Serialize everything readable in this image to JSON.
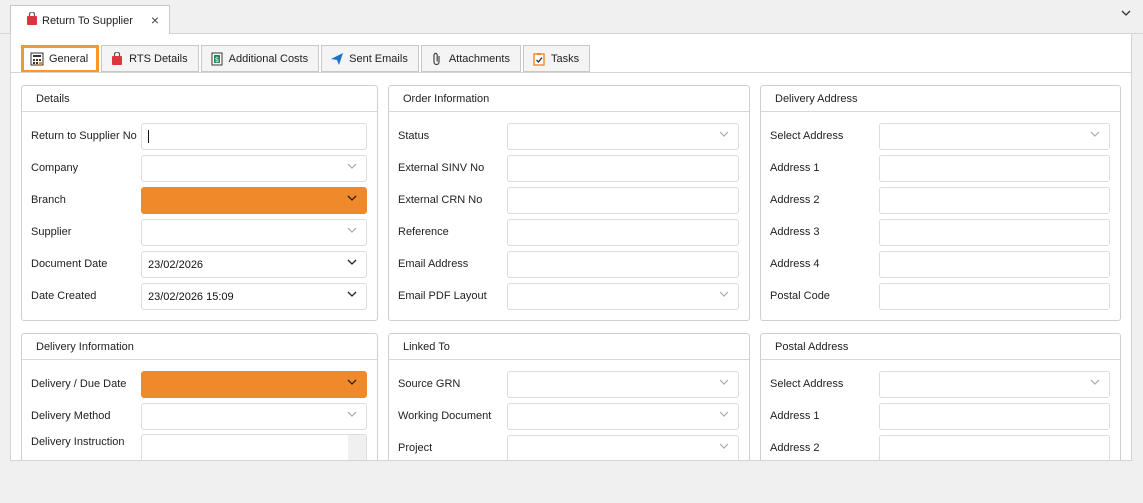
{
  "document_tab": {
    "title": "Return To Supplier",
    "close": "×"
  },
  "collapse_glyph": "⌄",
  "tabs": [
    {
      "label": "General",
      "icon": "calculator-icon"
    },
    {
      "label": "RTS Details",
      "icon": "shopping-bag-icon"
    },
    {
      "label": "Additional Costs",
      "icon": "dollar-document-icon"
    },
    {
      "label": "Sent Emails",
      "icon": "paper-plane-icon"
    },
    {
      "label": "Attachments",
      "icon": "paperclip-icon"
    },
    {
      "label": "Tasks",
      "icon": "clipboard-check-icon"
    }
  ],
  "colors": {
    "accent": "#f0892a",
    "active_tab_border": "#f39a2b"
  },
  "details": {
    "title": "Details",
    "return_no_label": "Return to Supplier No",
    "company_label": "Company",
    "branch_label": "Branch",
    "supplier_label": "Supplier",
    "document_date_label": "Document Date",
    "document_date_value": "23/02/2026",
    "date_created_label": "Date Created",
    "date_created_value": "23/02/2026 15:09"
  },
  "order_info": {
    "title": "Order Information",
    "status_label": "Status",
    "external_sinv_label": "External SINV No",
    "external_crn_label": "External CRN No",
    "reference_label": "Reference",
    "email_label": "Email Address",
    "email_pdf_label": "Email PDF Layout"
  },
  "delivery_address": {
    "title": "Delivery Address",
    "select_label": "Select Address",
    "address1_label": "Address 1",
    "address2_label": "Address 2",
    "address3_label": "Address 3",
    "address4_label": "Address 4",
    "postal_code_label": "Postal Code"
  },
  "delivery_info": {
    "title": "Delivery Information",
    "due_date_label": "Delivery / Due Date",
    "method_label": "Delivery Method",
    "instruction_label": "Delivery Instruction"
  },
  "linked_to": {
    "title": "Linked To",
    "source_grn_label": "Source GRN",
    "working_doc_label": "Working Document",
    "project_label": "Project"
  },
  "postal_address": {
    "title": "Postal Address",
    "select_label": "Select Address",
    "address1_label": "Address 1",
    "address2_label": "Address 2"
  }
}
